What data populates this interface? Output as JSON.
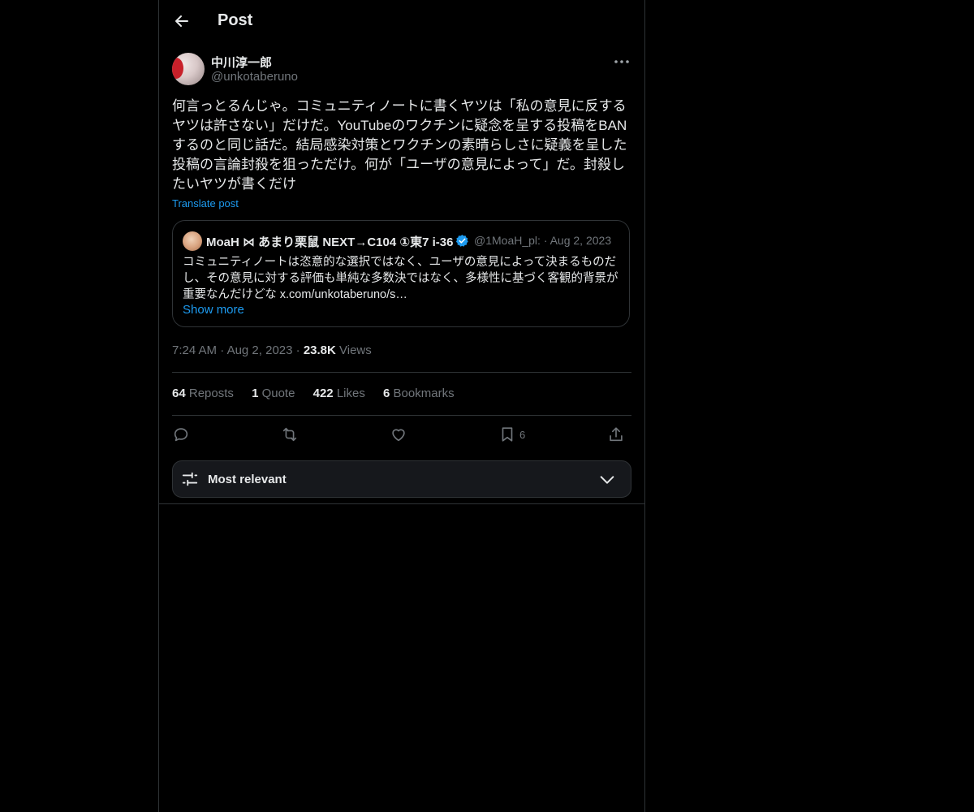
{
  "header": {
    "title": "Post"
  },
  "post": {
    "author_name": "中川淳一郎",
    "author_handle": "@unkotaberuno",
    "text": "何言っとるんじゃ。コミュニティノートに書くヤツは「私の意見に反する\nヤツは許さない」だけだ。YouTubeのワクチンに疑念を呈する投稿をBAN\nするのと同じ話だ。結局感染対策とワクチンの素晴らしさに疑義を呈した\n投稿の言論封殺を狙っただけ。何が「ユーザの意見によって」だ。封殺し\nたいヤツが書くだけ",
    "translate_label": "Translate post",
    "time": "7:24 AM",
    "date": "Aug 2, 2023",
    "views_count": "23.8K",
    "views_label": "Views"
  },
  "quoted": {
    "name": "MoaH ⋈ あまり栗鼠 NEXT→C104 ①東7 i-36",
    "handle": "@1MoaH_pl:",
    "date": "Aug 2, 2023",
    "text": "コミュニティノートは恣意的な選択ではなく、ユーザの意見によって決まるものだし、その意見に対する評価も単純な多数決ではなく、多様性に基づく客観的背景が重要なんだけどな x.com/unkotaberuno/s…",
    "show_more": "Show more"
  },
  "stats": {
    "reposts_count": "64",
    "reposts_label": "Reposts",
    "quote_count": "1",
    "quote_label": "Quote",
    "likes_count": "422",
    "likes_label": "Likes",
    "bookmarks_count": "6",
    "bookmarks_label": "Bookmarks"
  },
  "actions": {
    "bookmark_count": "6"
  },
  "sort": {
    "label": "Most relevant"
  },
  "colors": {
    "background": "#000000",
    "text": "#e7e9ea",
    "muted": "#71767b",
    "accent": "#1d9bf0",
    "border": "#2f3336"
  },
  "icons": [
    "arrow-left-icon",
    "more-horizontal-icon",
    "verified-badge-icon",
    "reply-icon",
    "repost-icon",
    "like-icon",
    "bookmark-icon",
    "share-icon",
    "sliders-icon",
    "chevron-down-icon"
  ]
}
